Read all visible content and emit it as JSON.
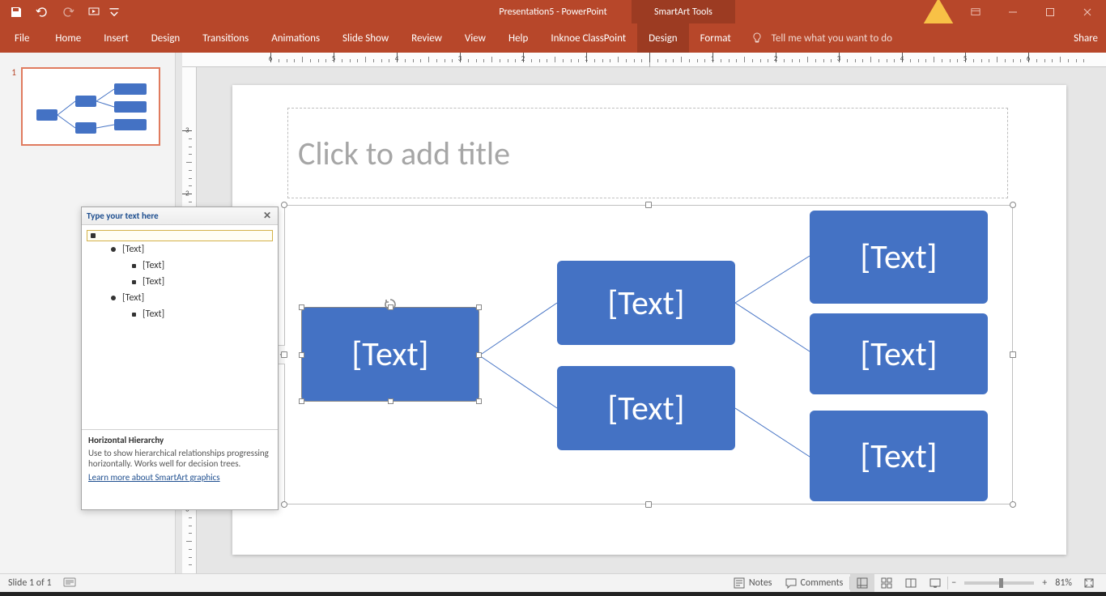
{
  "titlebar": {
    "docTitle": "Presentation5 - PowerPoint",
    "toolsTab": "SmartArt Tools"
  },
  "ribbon": {
    "file": "File",
    "tabs": [
      "Home",
      "Insert",
      "Design",
      "Transitions",
      "Animations",
      "Slide Show",
      "Review",
      "View",
      "Help",
      "Inknoe ClassPoint"
    ],
    "contextTabs": [
      "Design",
      "Format"
    ],
    "activeTab": "Design",
    "tellMe": "Tell me what you want to do",
    "share": "Share"
  },
  "thumbnails": {
    "items": [
      {
        "num": "1"
      }
    ]
  },
  "slide": {
    "titlePlaceholder": "Click to add title",
    "smartart": {
      "boxes": [
        "[Text]",
        "[Text]",
        "[Text]",
        "[Text]",
        "[Text]",
        "[Text]"
      ]
    }
  },
  "textPane": {
    "header": "Type your text here",
    "items": [
      {
        "level": 0,
        "text": "",
        "active": true
      },
      {
        "level": 1,
        "text": "[Text]"
      },
      {
        "level": 2,
        "text": "[Text]"
      },
      {
        "level": 2,
        "text": "[Text]"
      },
      {
        "level": 1,
        "text": "[Text]"
      },
      {
        "level": 2,
        "text": "[Text]"
      }
    ],
    "footer": {
      "title": "Horizontal Hierarchy",
      "desc": "Use to show hierarchical relationships progressing horizontally. Works well for decision trees.",
      "link": "Learn more about SmartArt graphics"
    }
  },
  "statusbar": {
    "slideInfo": "Slide 1 of 1",
    "notes": "Notes",
    "comments": "Comments",
    "zoom": "81%"
  },
  "ruler": {
    "hNums": [
      "6",
      "5",
      "4",
      "3",
      "2",
      "1",
      "1",
      "2",
      "3",
      "4",
      "5",
      "6"
    ]
  }
}
